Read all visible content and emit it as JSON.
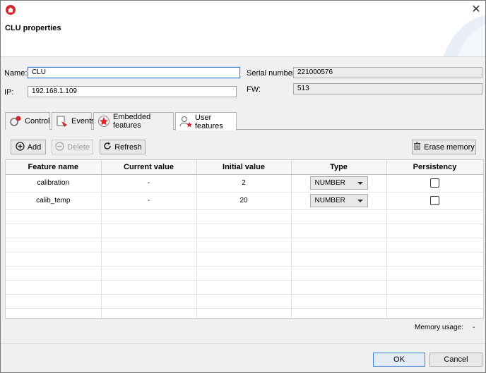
{
  "window": {
    "title": "CLU properties",
    "close_glyph": "✕",
    "app_icon": "home-icon",
    "accent_color": "#d8262f"
  },
  "props": {
    "name_label": "Name:",
    "name_value": "CLU",
    "ip_label": "IP:",
    "ip_value": "192.168.1.109",
    "serial_label": "Serial number:",
    "serial_value": "221000576",
    "fw_label": "FW:",
    "fw_value": "513"
  },
  "tabs": [
    {
      "label": "Control",
      "icon": "control-icon"
    },
    {
      "label": "Events",
      "icon": "events-icon"
    },
    {
      "label": "Embedded features",
      "icon": "star-icon"
    },
    {
      "label": "User features",
      "icon": "user-star-icon",
      "active": true
    }
  ],
  "toolbar": {
    "add_label": "Add",
    "delete_label": "Delete",
    "refresh_label": "Refresh",
    "erase_label": "Erase memory"
  },
  "table": {
    "columns": [
      "Feature name",
      "Current value",
      "Initial value",
      "Type",
      "Persistency"
    ],
    "rows": [
      {
        "name": "calibration",
        "current": "-",
        "initial": "2",
        "type": "NUMBER",
        "persistent": false
      },
      {
        "name": "calib_temp",
        "current": "-",
        "initial": "20",
        "type": "NUMBER",
        "persistent": false
      }
    ]
  },
  "memory": {
    "label": "Memory usage:",
    "value": "-"
  },
  "footer": {
    "ok_label": "OK",
    "cancel_label": "Cancel"
  }
}
